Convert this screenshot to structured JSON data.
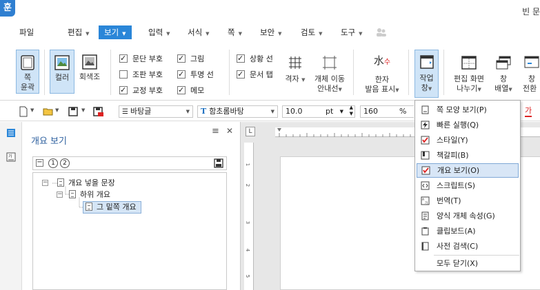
{
  "app": {
    "logo": "훈",
    "doc_title": "빈 문"
  },
  "menubar": {
    "items": [
      {
        "label": "파일",
        "has_arrow": false
      },
      {
        "label": "편집",
        "has_arrow": true
      },
      {
        "label": "보기",
        "has_arrow": true,
        "active": true
      },
      {
        "label": "입력",
        "has_arrow": true
      },
      {
        "label": "서식",
        "has_arrow": true
      },
      {
        "label": "쪽",
        "has_arrow": true
      },
      {
        "label": "보안",
        "has_arrow": true
      },
      {
        "label": "검토",
        "has_arrow": true
      },
      {
        "label": "도구",
        "has_arrow": true
      }
    ]
  },
  "ribbon": {
    "page_outline": {
      "line1": "쪽",
      "line2": "윤곽"
    },
    "color": "컬러",
    "grayscale": "회색조",
    "checks": [
      {
        "label": "문단 부호",
        "checked": true
      },
      {
        "label": "조판 부호",
        "checked": false
      },
      {
        "label": "교정 부호",
        "checked": true
      },
      {
        "label": "그림",
        "checked": true
      },
      {
        "label": "투명 선",
        "checked": true
      },
      {
        "label": "메모",
        "checked": true
      },
      {
        "label": "상황 선",
        "checked": true
      },
      {
        "label": "문서 탭",
        "checked": true
      }
    ],
    "grid": "격자",
    "object_move": {
      "line1": "개체 이동",
      "line2": "안내선"
    },
    "hanja": {
      "line1": "한자",
      "line2": "발음 표시"
    },
    "task_pane": {
      "line1": "작업",
      "line2": "창"
    },
    "edit_screen": {
      "line1": "편집 화면",
      "line2": "나누기"
    },
    "window_arrange": {
      "line1": "창",
      "line2": "배열"
    },
    "window_switch": {
      "line1": "창",
      "line2": "전환"
    }
  },
  "fmtbar": {
    "style": "바탕글",
    "font": "함초롬바탕",
    "size": "10.0",
    "size_unit": "pt",
    "zoom": "160",
    "zoom_unit": "%"
  },
  "panel": {
    "title": "개요 보기",
    "levels": [
      "1",
      "2"
    ],
    "tree": [
      {
        "label": "개요 넣을 문장"
      },
      {
        "label": "하위 개요"
      },
      {
        "label": "그 밑쪽 개요"
      }
    ]
  },
  "ruler": {
    "v_marks": [
      "1",
      "2",
      "3",
      "4",
      "5"
    ]
  },
  "dropdown": {
    "items": [
      "쪽 모양 보기(P)",
      "빠른 실행(Q)",
      "스타일(Y)",
      "책갈피(B)",
      "개요 보기(O)",
      "스크립트(S)",
      "번역(T)",
      "양식 개체 속성(G)",
      "클립보드(A)",
      "사전 검색(C)",
      "모두 닫기(X)"
    ]
  },
  "colors": {
    "accent": "#2a86d8",
    "selected_bg": "#cfe4f7",
    "panel_title": "#2c5f9e"
  }
}
